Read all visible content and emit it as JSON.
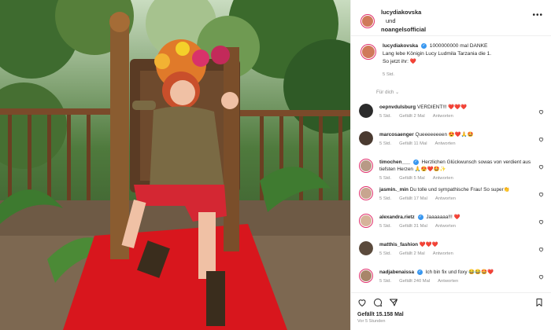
{
  "header": {
    "account_1": "lucydiakovska",
    "and_word": "und",
    "account_2": "noangelsofficial",
    "more_icon": "more-horizontal-icon"
  },
  "caption": {
    "username": "lucydiakovska",
    "line_1": "1000000000 mal DANKE",
    "line_2": "Lang lebe Königin Lucy Ludmila Tarzania die 1.",
    "line_3": "So jetzt ihr: ❤️",
    "time": "5 Std."
  },
  "sort_label": "Für dich ⌄",
  "comments": [
    {
      "user": "oepnvdulsburg",
      "verified": false,
      "text": "VERDIENT!!! ❤️❤️❤️",
      "time": "5 Std.",
      "likes": "Gefällt 2 Mal",
      "reply": "Antworten"
    },
    {
      "user": "marcosaenger",
      "verified": false,
      "text": "Queeeeeeeen 😍❤️🙏🤩",
      "time": "5 Std.",
      "likes": "Gefällt 11 Mal",
      "reply": "Antworten"
    },
    {
      "user": "timochen___",
      "verified": true,
      "text": "Herzlichen Glückwunsch sowas von verdient aus tiefsten Herzen 🙏😍❤️🤩✨",
      "time": "5 Std.",
      "likes": "Gefällt 5 Mal",
      "reply": "Antworten"
    },
    {
      "user": "jasmin._min",
      "verified": false,
      "text": "Du tolle und sympathische Frau! So super👏",
      "time": "5 Std.",
      "likes": "Gefällt 17 Mal",
      "reply": "Antworten"
    },
    {
      "user": "alexandra.rietz",
      "verified": true,
      "text": "Jaaaaaaa!!! ❤️",
      "time": "5 Std.",
      "likes": "Gefällt 31 Mal",
      "reply": "Antworten"
    },
    {
      "user": "matthis_fashion",
      "verified": false,
      "text": "❤️❤️❤️",
      "time": "5 Std.",
      "likes": "Gefällt 2 Mal",
      "reply": "Antworten"
    },
    {
      "user": "nadjabenaissa",
      "verified": true,
      "text": "Ich bin fix und foxy 😂😂🤩❤️",
      "time": "5 Std.",
      "likes": "Gefällt 240 Mal",
      "reply": "Antworten"
    }
  ],
  "footer": {
    "likes": "Gefällt 15.158 Mal",
    "time": "Vor 5 Stunden",
    "icons": [
      "heart-icon",
      "comment-icon",
      "share-icon",
      "bookmark-icon"
    ]
  },
  "colors": {
    "verified": "#3897f0",
    "carpet": "#d8161d",
    "link": "#00376b"
  }
}
